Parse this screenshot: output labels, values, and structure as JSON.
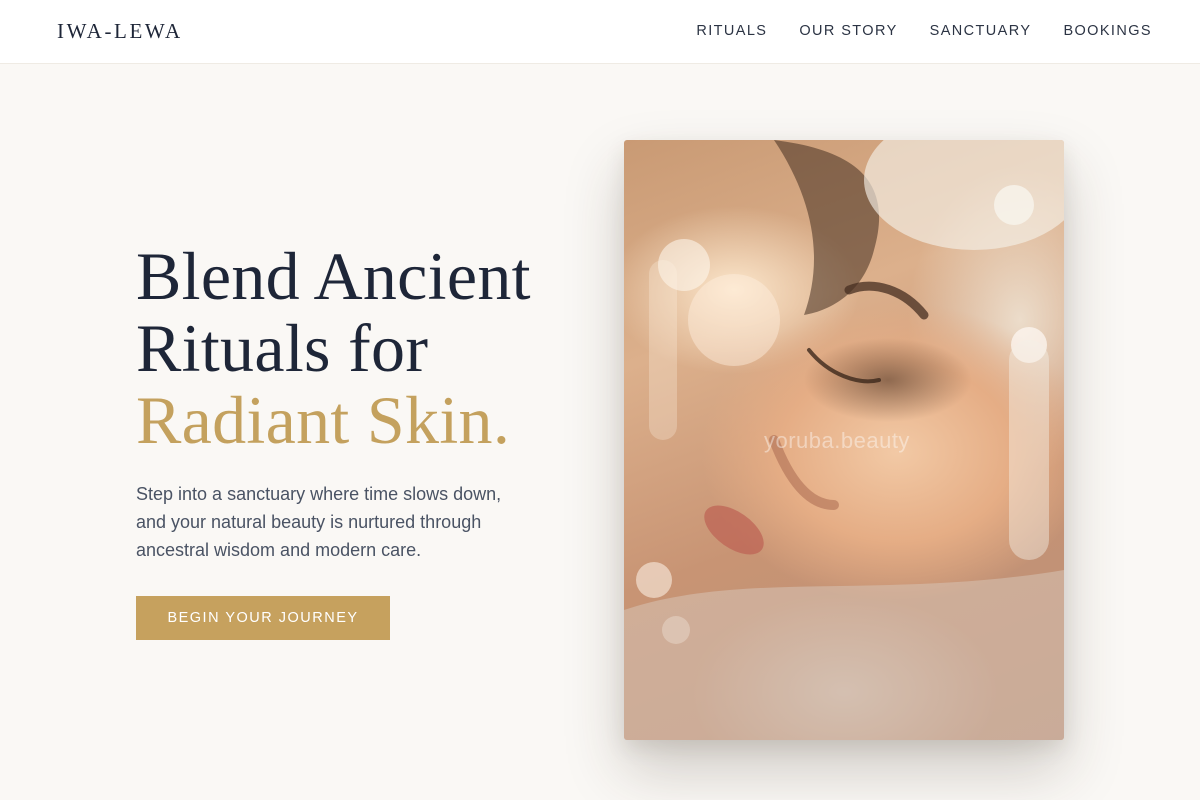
{
  "brand": {
    "name": "IWA-LEWA"
  },
  "nav": {
    "items": [
      {
        "label": "RITUALS"
      },
      {
        "label": "OUR STORY"
      },
      {
        "label": "SANCTUARY"
      },
      {
        "label": "BOOKINGS"
      }
    ]
  },
  "hero": {
    "title_line1": "Blend Ancient",
    "title_line2": "Rituals for",
    "title_accent": "Radiant Skin.",
    "subtitle_line1": "Step into a sanctuary where time slows down,",
    "subtitle_line2": "and your natural beauty is nurtured through",
    "subtitle_line3": "ancestral wisdom and modern care.",
    "cta_label": "BEGIN YOUR JOURNEY",
    "image_watermark": "yoruba.beauty"
  },
  "colors": {
    "accent": "#c4a15e",
    "heading": "#1e2638",
    "body_text": "#4a5364",
    "background": "#faf8f5"
  }
}
